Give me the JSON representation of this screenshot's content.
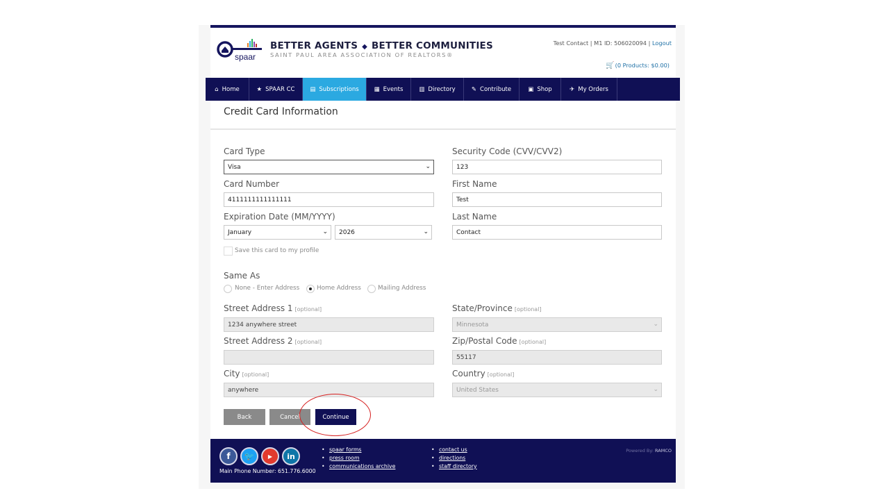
{
  "header": {
    "tagline_left": "BETTER AGENTS",
    "tagline_right": "BETTER COMMUNITIES",
    "subtagline": "SAINT PAUL AREA ASSOCIATION OF REALTORS®",
    "logo_text": "spaar",
    "user_info": "Test Contact | M1 ID: 506020094 |",
    "logout": "Logout",
    "cart": "(0 Products: $0.00)"
  },
  "nav": {
    "items": [
      {
        "label": "Home",
        "icon": "home-icon"
      },
      {
        "label": "SPAAR CC",
        "icon": "star-icon"
      },
      {
        "label": "Subscriptions",
        "icon": "subscriptions-icon"
      },
      {
        "label": "Events",
        "icon": "events-icon"
      },
      {
        "label": "Directory",
        "icon": "directory-icon"
      },
      {
        "label": "Contribute",
        "icon": "contribute-icon"
      },
      {
        "label": "Shop",
        "icon": "shop-icon"
      },
      {
        "label": "My Orders",
        "icon": "orders-icon"
      }
    ],
    "active": "Subscriptions"
  },
  "form": {
    "title": "Credit Card Information",
    "card_type_label": "Card Type",
    "card_type_value": "Visa",
    "card_number_label": "Card Number",
    "card_number_value": "4111111111111111",
    "expiration_label": "Expiration Date (MM/YYYY)",
    "exp_month": "January",
    "exp_year": "2026",
    "save_card_label": "Save this card to my profile",
    "security_code_label": "Security Code (CVV/CVV2)",
    "security_code_value": "123",
    "first_name_label": "First Name",
    "first_name_value": "Test",
    "last_name_label": "Last Name",
    "last_name_value": "Contact",
    "same_as_label": "Same As",
    "same_as_options": [
      "None - Enter Address",
      "Home Address",
      "Mailing Address"
    ],
    "same_as_selected": "Home Address",
    "optional": "[optional]",
    "street1_label": "Street Address 1",
    "street1_value": "1234 anywhere street",
    "street2_label": "Street Address 2",
    "street2_value": "",
    "city_label": "City",
    "city_value": "anywhere",
    "state_label": "State/Province",
    "state_value": "Minnesota",
    "zip_label": "Zip/Postal Code",
    "zip_value": "55117",
    "country_label": "Country",
    "country_value": "United States"
  },
  "buttons": {
    "back": "Back",
    "cancel": "Cancel",
    "continue": "Continue"
  },
  "footer": {
    "phone": "Main Phone Number: 651.776.6000",
    "links_col1": [
      "spaar forms",
      "press room",
      "communications archive"
    ],
    "links_col2": [
      "contact us",
      "directions",
      "staff directory"
    ],
    "powered_by": "Powered By:",
    "powered_brand": "RAMCO"
  },
  "colors": {
    "navy": "#101055",
    "active_tab": "#2ba9e1",
    "annotation": "#d62020"
  }
}
